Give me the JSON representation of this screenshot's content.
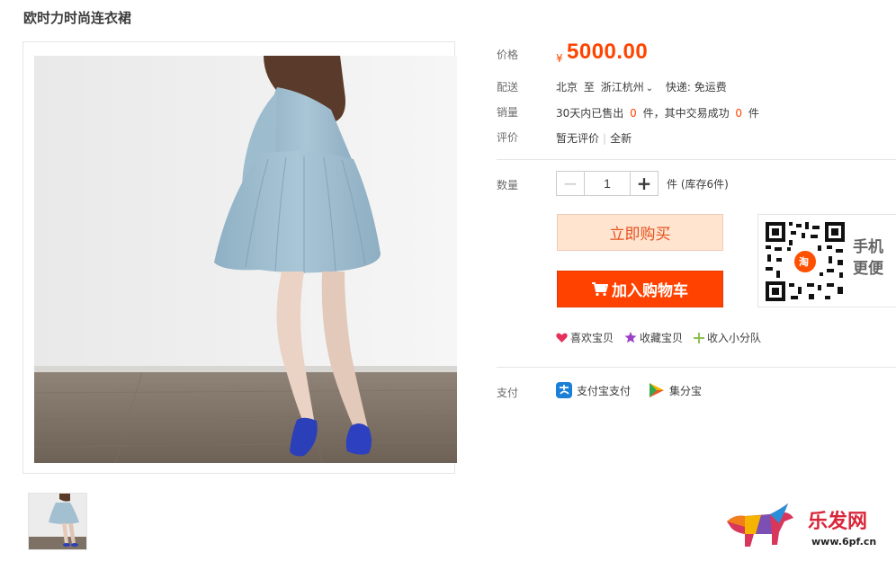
{
  "product": {
    "title": "欧时力时尚连衣裙"
  },
  "labels": {
    "price": "价格",
    "shipping": "配送",
    "sales": "销量",
    "review": "评价",
    "quantity": "数量",
    "payment": "支付"
  },
  "price": {
    "currency": "¥",
    "value": "5000.00"
  },
  "shipping": {
    "from": "北京",
    "to_word": "至",
    "to": "浙江杭州",
    "express": "快递: 免运费"
  },
  "sales": {
    "prefix": "30天内已售出",
    "sold": "0",
    "unit1": "件，其中交易成功",
    "success": "0",
    "unit2": "件"
  },
  "review": {
    "none": "暂无评价",
    "condition": "全新"
  },
  "quantity": {
    "value": "1",
    "minus": "−",
    "plus": "+",
    "stock": "件 (库存6件)"
  },
  "buttons": {
    "buy_now": "立即购买",
    "add_cart": "加入购物车"
  },
  "qr": {
    "line1": "手机",
    "line2": "更便",
    "logo_char": "淘"
  },
  "actions": {
    "like": "喜欢宝贝",
    "favorite": "收藏宝贝",
    "group": "收入小分队"
  },
  "payment": {
    "alipay": "支付宝支付",
    "jifen": "集分宝"
  },
  "watermark": {
    "name": "乐发网",
    "url": "www.6pf.cn"
  },
  "colors": {
    "accent": "#ff4400",
    "buy_bg": "#ffe4d0",
    "cart_bg": "#ff4200"
  }
}
